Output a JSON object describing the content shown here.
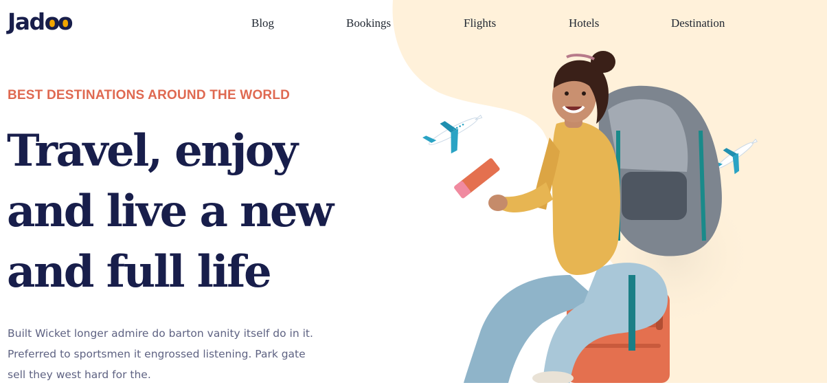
{
  "brand": {
    "logo_text": "Jadoo"
  },
  "nav": {
    "items": [
      {
        "label": "Blog"
      },
      {
        "label": "Bookings"
      },
      {
        "label": "Flights"
      },
      {
        "label": "Hotels"
      },
      {
        "label": "Destination"
      }
    ]
  },
  "hero": {
    "eyebrow": "BEST DESTINATIONS AROUND THE WORLD",
    "headline_lines": [
      "Travel, enjoy",
      "and live a new",
      "and full life"
    ],
    "description": "Built Wicket longer admire do barton vanity itself do in it. Preferred to sportsmen it engrossed listening. Park gate sell they west hard for the."
  },
  "colors": {
    "brand_navy": "#181e4b",
    "accent_orange": "#df6951",
    "logo_yellow": "#f1a501",
    "body_text": "#5e6282",
    "blob_cream": "#fff1da",
    "plane_teal": "#2aa3c4"
  },
  "icons": {
    "illustration": "traveler-with-backpack-on-suitcase",
    "planes": [
      "airplane-icon",
      "airplane-icon"
    ]
  }
}
